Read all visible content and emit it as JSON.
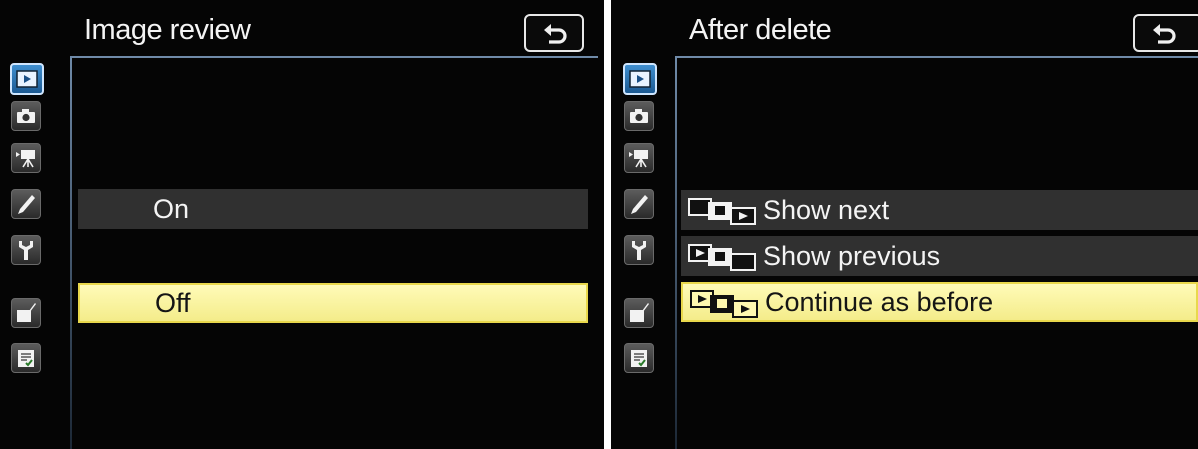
{
  "screens": [
    {
      "title": "Image review",
      "items": [
        {
          "label": "On",
          "state": "dim"
        },
        {
          "label": "Off",
          "state": "selected"
        }
      ]
    },
    {
      "title": "After delete",
      "items": [
        {
          "label": "Show next",
          "icon": "show-next-icon",
          "state": "dim"
        },
        {
          "label": "Show previous",
          "icon": "show-previous-icon",
          "state": "dim"
        },
        {
          "label": "Continue as before",
          "icon": "continue-as-before-icon",
          "state": "selected"
        }
      ]
    }
  ],
  "tabs": [
    {
      "icon": "playback-menu-icon",
      "active": true
    },
    {
      "icon": "camera-menu-icon"
    },
    {
      "icon": "movie-menu-icon"
    },
    {
      "icon": "pencil-custom-settings-icon"
    },
    {
      "icon": "wrench-setup-menu-icon"
    },
    {
      "icon": "retouch-menu-icon"
    },
    {
      "icon": "my-menu-icon"
    }
  ],
  "colors": {
    "screen_bg": "#050505",
    "accent_rule": "#6f8aa8",
    "selected_row": "#f8f1a0",
    "dim_row": "#303030",
    "active_tab": "#2f7cc0"
  }
}
